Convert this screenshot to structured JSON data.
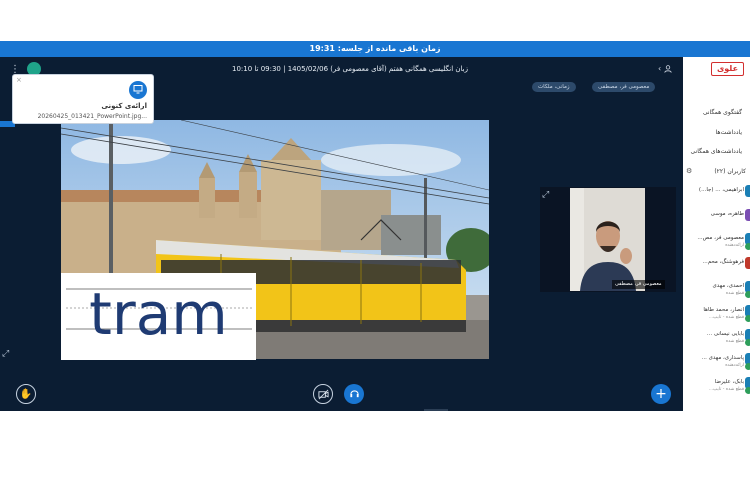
{
  "timer_bar": {
    "text": "زمان باقی مانده از جلسه: 19:31"
  },
  "header": {
    "title": "زبان انگلیسی همگانی هفتم (آقای معصومی فر) 1405/02/06 | 09:30 تا 10:10",
    "chips": [
      "معصومی فر، مصطفی",
      "زمانی، ملکات"
    ]
  },
  "notification": {
    "title": "ارائه‌ی کنونی",
    "file": "20260425_013421_PowerPoint.jpg...",
    "close": "×"
  },
  "slide": {
    "word": "tram",
    "colors": {
      "word": "#1f3b73",
      "sky": "#bcd6ee",
      "tram_yellow": "#f2c418"
    }
  },
  "camera": {
    "label": "معصومی فر، مصطفی"
  },
  "sidebar": {
    "logo": "علوی",
    "links": [
      "گفتگوی همگانی",
      "یادداشت‌ها",
      "یادداشت‌های همگانی"
    ],
    "section": "کاربران (۲۲)",
    "members": [
      {
        "name": "ابراهیمی، ... (جا...)",
        "sub": "",
        "avatar_color": "#1a7fb5"
      },
      {
        "name": "طاهره، موسی",
        "sub": "",
        "avatar_color": "#7b4fb3"
      },
      {
        "name": "معصومی فر، مص...",
        "sub": "ارائه‌دهنده",
        "avatar_color": "#1a7fb5"
      },
      {
        "name": "فرهوشنگ، محم...",
        "sub": "",
        "avatar_color": "#c0392b"
      },
      {
        "name": "احمدی، مهدی",
        "sub": "قطع شده",
        "avatar_color": "#1a7fb5"
      },
      {
        "name": "انصار، محمد طاها",
        "sub": "قطع شده - تایپ...",
        "avatar_color": "#1a7fb5"
      },
      {
        "name": "بابایی نیسانی ...",
        "sub": "قطع شده",
        "avatar_color": "#1a7fb5"
      },
      {
        "name": "پاسداری، مهدی ...",
        "sub": "ارائه‌دهنده",
        "avatar_color": "#1a7fb5"
      },
      {
        "name": "بابک، علیرضا",
        "sub": "قطع شده - تایپ...",
        "avatar_color": "#1a7fb5"
      }
    ]
  },
  "icons": {
    "user": "user-icon",
    "menu": "kebab-menu-icon",
    "hand": "raise-hand-icon",
    "camera_off": "camera-off-icon",
    "headset": "headset-icon",
    "plus": "plus-icon",
    "expand": "expand-icon",
    "monitor": "monitor-icon",
    "gear": "gear-icon"
  }
}
